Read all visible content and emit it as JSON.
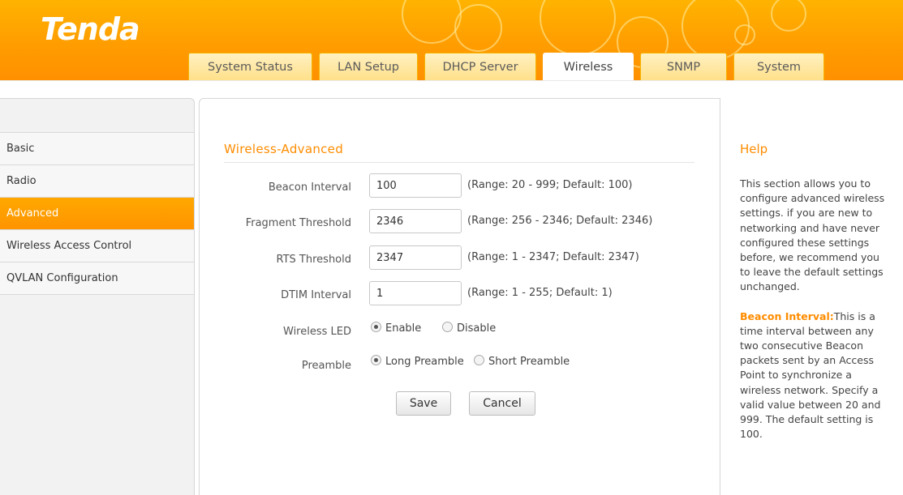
{
  "brand": {
    "logo_text": "Tenda"
  },
  "colors": {
    "accent": "#ff9900",
    "title_orange": "#ff8c00",
    "tab_bg": "#ffe08a"
  },
  "tabs": [
    {
      "label": "System Status",
      "active": false
    },
    {
      "label": "LAN Setup",
      "active": false
    },
    {
      "label": "DHCP Server",
      "active": false
    },
    {
      "label": "Wireless",
      "active": true
    },
    {
      "label": "SNMP",
      "active": false
    },
    {
      "label": "System",
      "active": false
    }
  ],
  "sidebar": {
    "items": [
      {
        "label": "Basic",
        "active": false
      },
      {
        "label": "Radio",
        "active": false
      },
      {
        "label": "Advanced",
        "active": true
      },
      {
        "label": "Wireless Access Control",
        "active": false
      },
      {
        "label": "QVLAN Configuration",
        "active": false
      }
    ]
  },
  "form": {
    "title": "Wireless-Advanced",
    "beacon": {
      "label": "Beacon Interval",
      "value": "100",
      "range": "(Range: 20 - 999; Default: 100)"
    },
    "fragment": {
      "label": "Fragment Threshold",
      "value": "2346",
      "range": "(Range: 256 - 2346; Default: 2346)"
    },
    "rts": {
      "label": "RTS Threshold",
      "value": "2347",
      "range": "(Range: 1 - 2347; Default: 2347)"
    },
    "dtim": {
      "label": "DTIM Interval",
      "value": "1",
      "range": "(Range: 1 - 255; Default: 1)"
    },
    "led": {
      "label": "Wireless LED",
      "option_enable": "Enable",
      "option_disable": "Disable",
      "selected": "Enable"
    },
    "preamble": {
      "label": "Preamble",
      "option_long": "Long Preamble",
      "option_short": "Short Preamble",
      "selected": "Long Preamble"
    },
    "save_label": "Save",
    "cancel_label": "Cancel"
  },
  "help": {
    "title": "Help",
    "intro": "This section allows you to configure advanced wireless settings. if you are new to networking and have never configured these settings before, we recommend you to leave the default settings unchanged.",
    "beacon_key": "Beacon Interval:",
    "beacon_text": "This is a time interval between any two consecutive Beacon packets sent by an Access Point to synchronize a wireless network. Specify a valid value between 20 and 999. The default setting is 100."
  }
}
